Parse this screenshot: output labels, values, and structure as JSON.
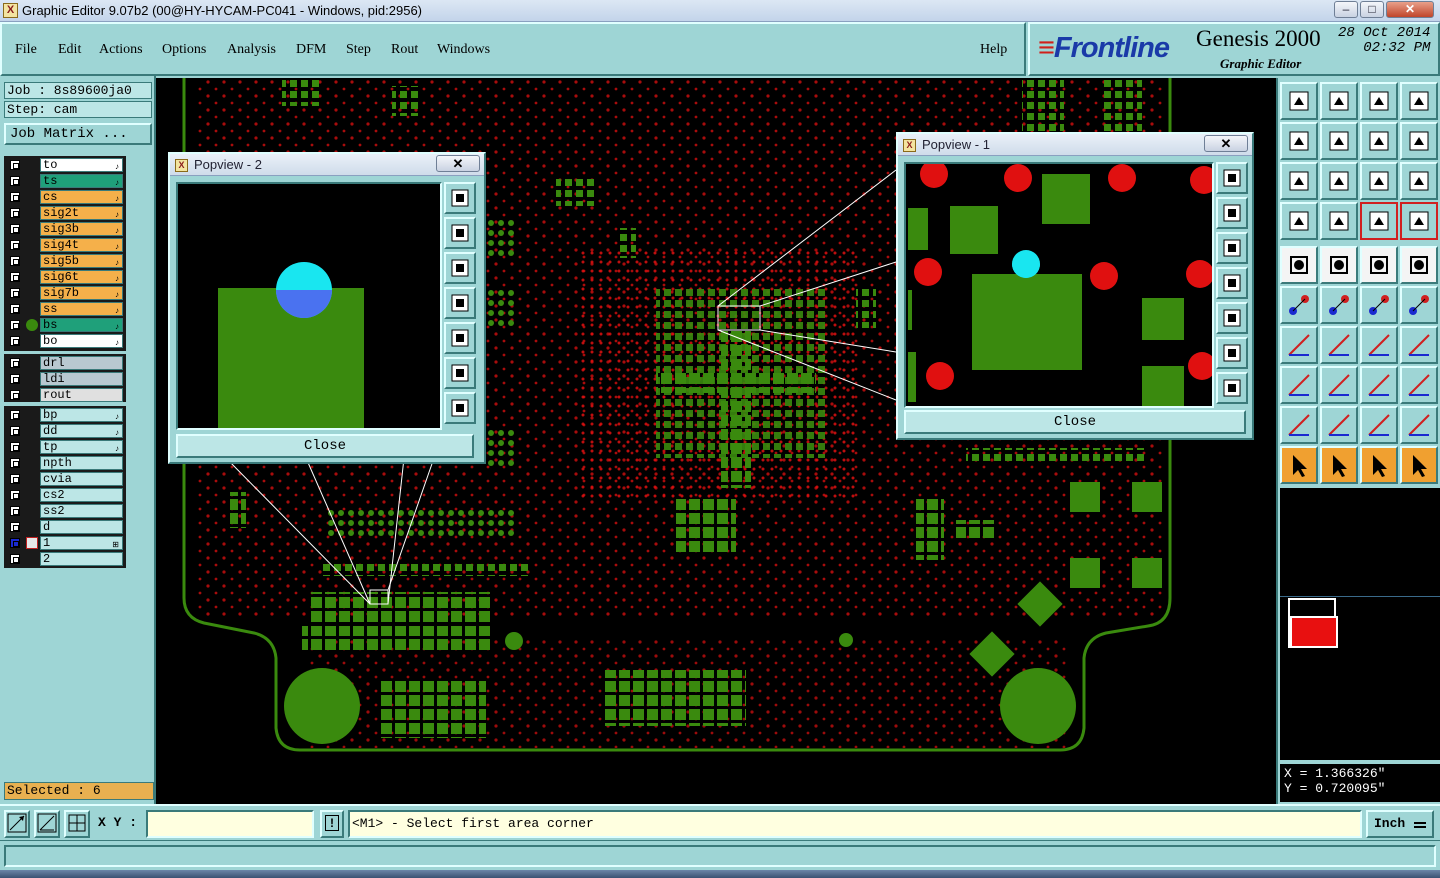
{
  "window": {
    "title": "Graphic Editor 9.07b2 (00@HY-HYCAM-PC041 - Windows, pid:2956)",
    "controls": {
      "minimize": "–",
      "maximize": "□",
      "close": "✕"
    }
  },
  "menu": {
    "items": [
      "File",
      "Edit",
      "Actions",
      "Options",
      "Analysis",
      "DFM",
      "Step",
      "Rout",
      "Windows"
    ],
    "help": "Help"
  },
  "brand": {
    "logo_prefix": "≡",
    "logo": "Frontline",
    "product": "Genesis 2000",
    "subtitle": "Graphic Editor",
    "date": "28 Oct 2014",
    "time": "02:32 PM"
  },
  "left": {
    "job": "Job : 8s89600ja0",
    "step": "Step: cam",
    "job_matrix": "Job Matrix ...",
    "layers_group1": [
      {
        "name": "to",
        "color": "#ffffff",
        "cap": "♪"
      },
      {
        "name": "ts",
        "color": "#1fa07a",
        "cap": "♪"
      },
      {
        "name": "cs",
        "color": "#f5b04a",
        "cap": "♪"
      },
      {
        "name": "sig2t",
        "color": "#f5b04a",
        "cap": "♪"
      },
      {
        "name": "sig3b",
        "color": "#f5b04a",
        "cap": "♪"
      },
      {
        "name": "sig4t",
        "color": "#f5b04a",
        "cap": "♪"
      },
      {
        "name": "sig5b",
        "color": "#f5b04a",
        "cap": "♪"
      },
      {
        "name": "sig6t",
        "color": "#f5b04a",
        "cap": "♪"
      },
      {
        "name": "sig7b",
        "color": "#f5b04a",
        "cap": "♪"
      },
      {
        "name": "ss",
        "color": "#f5b04a",
        "cap": "♪"
      },
      {
        "name": "bs",
        "color": "#1fa07a",
        "cap": "♪"
      },
      {
        "name": "bo",
        "color": "#ffffff",
        "cap": "♪"
      }
    ],
    "layers_group2": [
      {
        "name": "drl",
        "color": "#b8c8d0"
      },
      {
        "name": "ldi",
        "color": "#b8c8d0"
      },
      {
        "name": "rout",
        "color": "#e0e0e0"
      }
    ],
    "layers_group3": [
      {
        "name": "bp",
        "color": "#bce6e6",
        "cap": "♪"
      },
      {
        "name": "dd",
        "color": "#bce6e6",
        "cap": "♪"
      },
      {
        "name": "tp",
        "color": "#bce6e6",
        "cap": "♪"
      },
      {
        "name": "npth",
        "color": "#bce6e6",
        "cap": ""
      },
      {
        "name": "cvia",
        "color": "#bce6e6",
        "cap": ""
      },
      {
        "name": "cs2",
        "color": "#bce6e6",
        "cap": ""
      },
      {
        "name": "ss2",
        "color": "#bce6e6",
        "cap": ""
      },
      {
        "name": "d",
        "color": "#bce6e6",
        "cap": ""
      },
      {
        "name": "1",
        "color": "#bce6e6",
        "cap": "⊞"
      },
      {
        "name": "2",
        "color": "#bce6e6",
        "cap": ""
      }
    ],
    "selected": "Selected : 6"
  },
  "popview2": {
    "title": "Popview - 2",
    "close": "Close"
  },
  "popview1": {
    "title": "Popview - 1",
    "close": "Close"
  },
  "right": {
    "coord_x": "X = 1.366326\"",
    "coord_y": "Y = 0.720095\""
  },
  "bottom": {
    "xy_label": "X Y :",
    "xy_value": "",
    "exclaim": "!",
    "message": "<M1> - Select first area corner",
    "units": "Inch"
  },
  "colors": {
    "panel": "#9ed5d5",
    "pad_green": "#3a8a0e",
    "drill_red": "#e01010",
    "highlight_cyan": "#19e6f0"
  }
}
